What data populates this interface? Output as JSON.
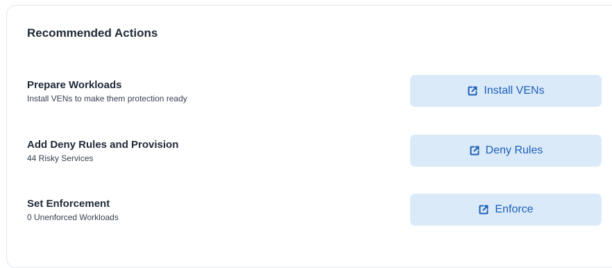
{
  "card": {
    "title": "Recommended Actions"
  },
  "actions": [
    {
      "title": "Prepare Workloads",
      "subtitle": "Install VENs to make them protection ready",
      "button_label": "Install VENs",
      "button_icon": "external-link-icon"
    },
    {
      "title": "Add Deny Rules and Provision",
      "subtitle": "44 Risky Services",
      "button_label": "Deny Rules",
      "button_icon": "external-link-icon"
    },
    {
      "title": "Set Enforcement",
      "subtitle": "0 Unenforced Workloads",
      "button_label": "Enforce",
      "button_icon": "external-link-icon"
    }
  ],
  "colors": {
    "button_background": "#dbeaf9",
    "button_text": "#1d5fb8",
    "card_border": "#e3e7ee"
  }
}
